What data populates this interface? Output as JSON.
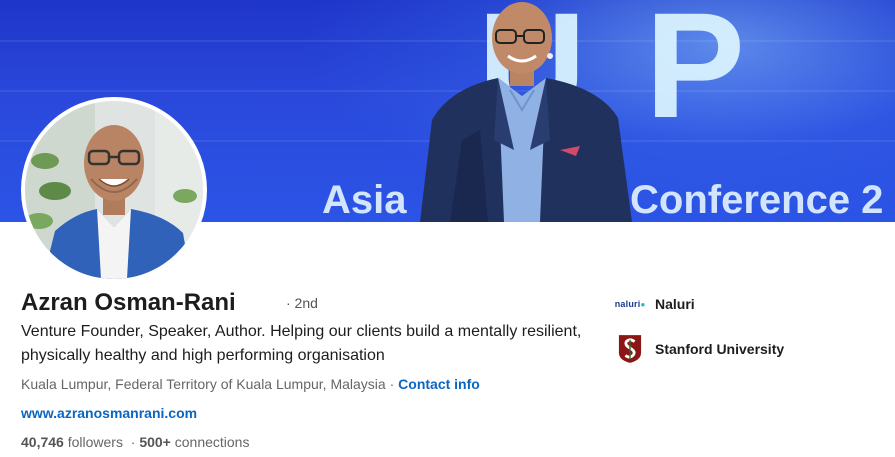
{
  "banner": {
    "letters": [
      "U",
      "P"
    ],
    "text_left": "Asia",
    "text_right": "Conference 2"
  },
  "profile": {
    "name": "Azran Osman-Rani",
    "degree": "· 2nd",
    "headline": "Venture Founder, Speaker, Author. Helping our clients build a mentally resilient, physically healthy and high performing organisation",
    "location": "Kuala Lumpur, Federal Territory of Kuala Lumpur, Malaysia",
    "location_separator": " · ",
    "contact_info_label": "Contact info",
    "website": "www.azranosmanrani.com",
    "followers_count": "40,746",
    "followers_label": " followers",
    "connections_separator": "  · ",
    "connections_count": "500+",
    "connections_label": " connections"
  },
  "organizations": [
    {
      "name": "Naluri",
      "logo_text": "naluri",
      "icon": "naluri-logo-icon"
    },
    {
      "name": "Stanford University",
      "icon": "stanford-logo-icon"
    }
  ],
  "colors": {
    "link": "#0a66c2",
    "banner_blue": "#2a49dc",
    "stanford_red": "#8c1515"
  }
}
